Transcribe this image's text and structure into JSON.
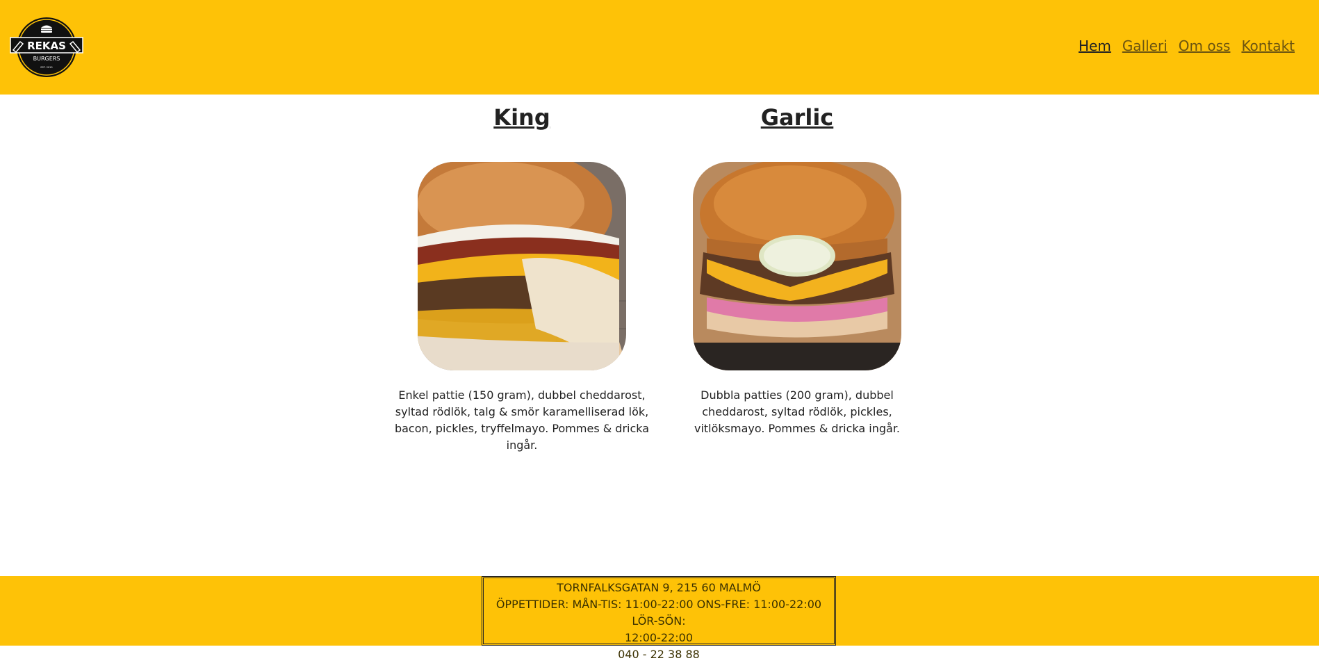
{
  "brand": {
    "logo_name": "REKAS",
    "logo_sub": "BURGERS",
    "logo_est": "EST. 2019"
  },
  "nav": [
    {
      "label": "Hem",
      "active": true
    },
    {
      "label": "Galleri",
      "active": false
    },
    {
      "label": "Om oss",
      "active": false
    },
    {
      "label": "Kontakt",
      "active": false
    }
  ],
  "menu": [
    {
      "title": "King",
      "image_alt": "burger-photo-king",
      "description": "Enkel pattie (150 gram), dubbel cheddarost, syltad rödlök, talg & smör karamelliserad lök, bacon, pickles, tryffelmayo. Pommes & dricka ingår."
    },
    {
      "title": "Garlic",
      "image_alt": "burger-photo-garlic",
      "description": "Dubbla patties (200 gram), dubbel cheddarost, syltad rödlök, pickles, vitlöksmayo. Pommes & dricka ingår."
    }
  ],
  "footer": {
    "address": "TORNFALKSGATAN 9, 215 60 MALMÖ",
    "hours_line1": "ÖPPETTIDER: MÅN-TIS: 11:00-22:00 ONS-FRE: 11:00-22:00 LÖR-SÖN:",
    "hours_line2": "12:00-22:00",
    "phone": "040 - 22 38 88"
  },
  "colors": {
    "header_bg": "#fec207",
    "footer_bg": "#fec207",
    "text": "#222222"
  }
}
